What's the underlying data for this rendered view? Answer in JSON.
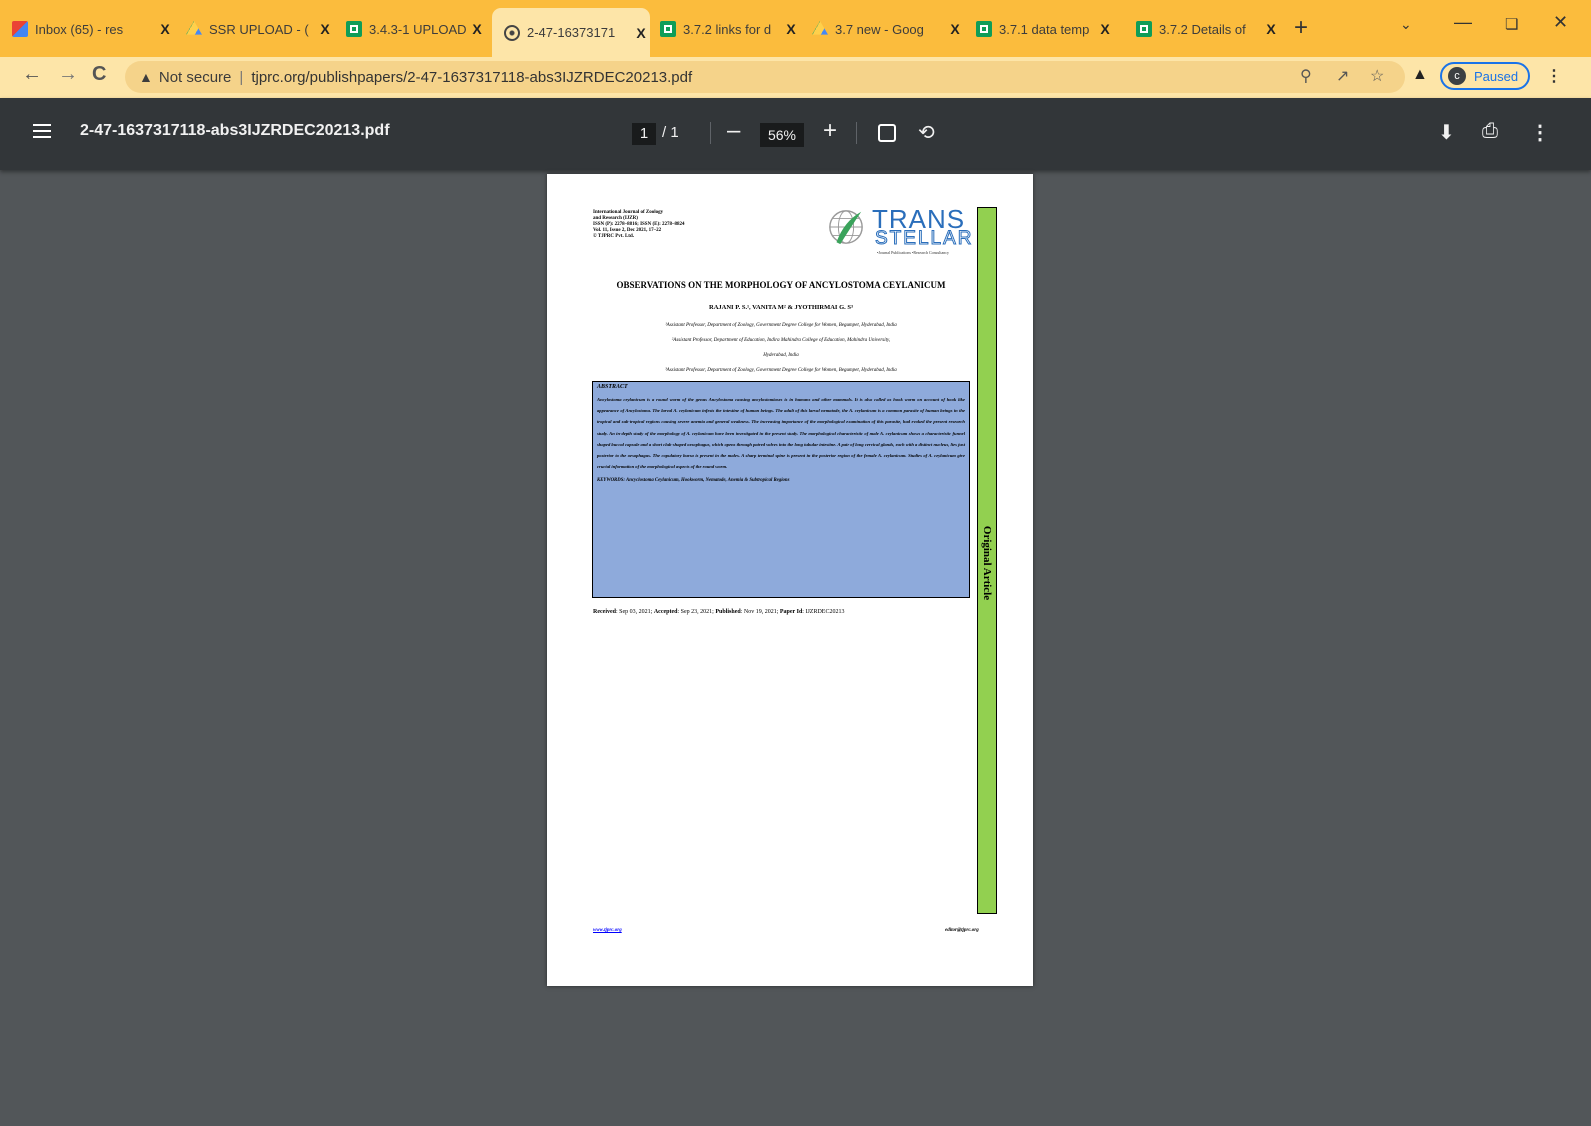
{
  "browser": {
    "tabs": [
      {
        "icon": "gmail-icon",
        "title": "Inbox (65) - res",
        "active": false
      },
      {
        "icon": "drive-icon",
        "title": "SSR UPLOAD - (",
        "active": false
      },
      {
        "icon": "sheets-icon",
        "title": "3.4.3-1 UPLOAD",
        "active": false
      },
      {
        "icon": "globe-icon",
        "title": "2-47-16373171",
        "active": true
      },
      {
        "icon": "sheets-icon",
        "title": "3.7.2 links for d",
        "active": false
      },
      {
        "icon": "drive-icon",
        "title": "3.7 new - Goog",
        "active": false
      },
      {
        "icon": "sheets-icon",
        "title": "3.7.1 data temp",
        "active": false
      },
      {
        "icon": "sheets-icon",
        "title": "3.7.2 Details of",
        "active": false
      }
    ],
    "close_glyph": "X",
    "newtab_glyph": "+",
    "url_warning": "Not secure",
    "url": "tjprc.org/publishpapers/2-47-1637317118-abs3IJZRDEC20213.pdf",
    "profile_initial": "c",
    "profile_label": "Paused",
    "accent": "#fbbc3d"
  },
  "pdf_viewer": {
    "filename": "2-47-1637317118-abs3IJZRDEC20213.pdf",
    "current_page": "1",
    "total_pages": "/ 1",
    "zoom": "56%"
  },
  "document": {
    "journal_header": [
      "International Journal of Zoology",
      "and Research (IJZR)",
      "ISSN (P): 2278–8816; ISSN (E): 2278–8824",
      "Vol. 11, Issue 2, Dec 2021, 17–22",
      "© TJPRC Pvt. Ltd."
    ],
    "logo_top": "TRANS",
    "logo_bottom": "STELLAR",
    "logo_tagline": "•Journal Publications  •Research Consultancy",
    "side_label": "Original Article",
    "title": "OBSERVATIONS ON THE MORPHOLOGY OF ANCYLOSTOMA CEYLANICUM",
    "authors": "RAJANI P. S.¹, VANITA M² & JYOTHIRMAI G. S³",
    "affiliations": [
      "¹Assistant Professor, Department of Zoology, Government Degree College for Women, Begumpet, Hyderabad, India",
      "²Assistant Professor, Department of Education, Indira Mahindra College of Education, Mahindra University,",
      "Hyderabad, India",
      "³Assistant Professor, Department of Zoology, Government Degree College for Women, Begumpet, Hyderabad, India"
    ],
    "abstract_heading": "ABSTRACT",
    "abstract_text": "Ancylostoma ceylanicum is a round worm of the genus Ancylostoma causing ancylostomiases is in humans and other mammals. It is also called as hook worm on account of hook like appearance of Ancylostoma. The larval A. ceylanicum infests the intestine of human beings. The adult of this larval nematode, the A. ceylanicum is a common parasite of human beings in the tropical and sub-tropical regions causing severe anemia and general weakness. The increasing importance of the morphological examination of this parasite, had evoked the present research study. An in-depth study of the morphology of A. ceylanicum have been investigated in the present study. The morphological characteristic of male A. ceylanicum shows a characteristic funnel shaped buccal capsule and a short club-shaped oesophagus, which opens through paired valves into the long tubular intestine. A pair of long cervical glands, each with a distinct nucleus, lies just posterior to the oesophagus. The copulatory bursa is present in the males. A sharp terminal spine is present in the posterior region of the female A. ceylanicum. Studies of A. ceylanicum give crucial information of the morphological aspects of the round worm.",
    "keywords": "KEYWORDS: Ancyclostoma Ceylanicum, Hookworm, Nematode, Anemia & Subtropical Regions",
    "received_label": "Received",
    "received": ": Sep 03, 2021; ",
    "accepted_label": "Accepted",
    "accepted": ": Sep 23, 2021; ",
    "published_label": "Published",
    "published": ": Nov 19, 2021; ",
    "paperid_label": "Paper Id",
    "paperid": ": IJZRDEC20213",
    "footer_left": "www.tjprc.org",
    "footer_right": "editor@tjprc.org"
  }
}
